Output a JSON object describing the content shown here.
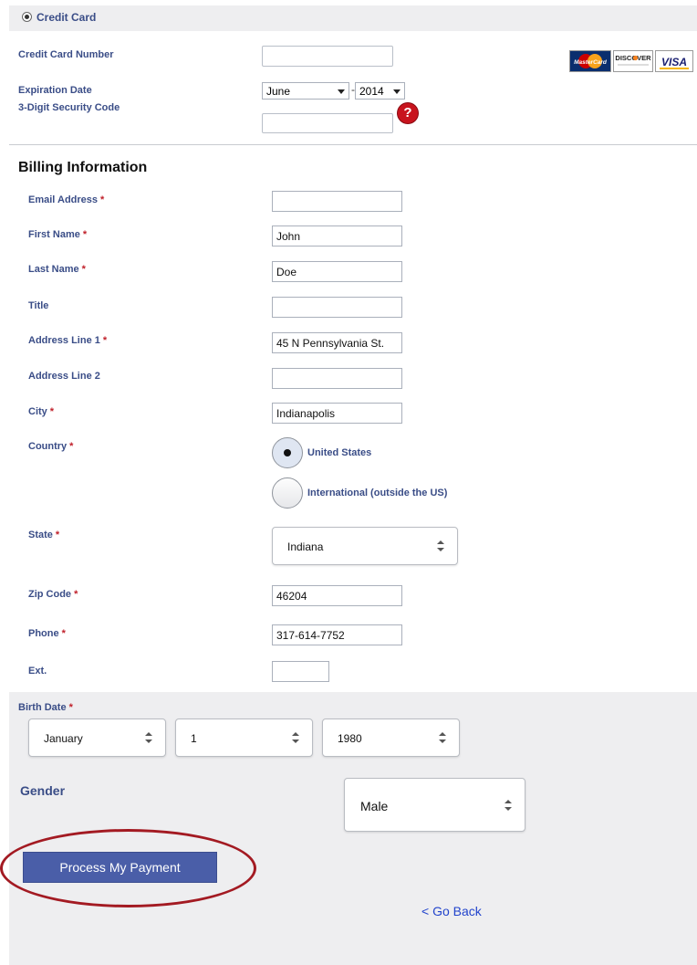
{
  "payment": {
    "method_label": "Credit Card",
    "card_number_label": "Credit Card Number",
    "card_number_value": "",
    "expiration_label": "Expiration Date",
    "exp_month": "June",
    "exp_sep": "-",
    "exp_year": "2014",
    "cvv_label": "3-Digit Security Code",
    "cvv_value": "",
    "help_glyph": "?",
    "cards": [
      {
        "name": "MasterCard",
        "color": "#cc0000"
      },
      {
        "name": "DISCOVER",
        "color": "#f58220"
      },
      {
        "name": "VISA",
        "color": "#1a1f71"
      }
    ]
  },
  "billing": {
    "heading": "Billing Information",
    "required_mark": "*",
    "email_label": "Email Address",
    "email_value": "",
    "first_name_label": "First Name",
    "first_name_value": "John",
    "last_name_label": "Last Name",
    "last_name_value": "Doe",
    "title_label": "Title",
    "title_value": "",
    "address1_label": "Address Line 1",
    "address1_value": "45 N Pennsylvania St.",
    "address2_label": "Address Line 2",
    "address2_value": "",
    "city_label": "City",
    "city_value": "Indianapolis",
    "country_label": "Country",
    "country_options": [
      "United States",
      "International (outside the US)"
    ],
    "state_label": "State",
    "state_value": "Indiana",
    "zip_label": "Zip Code",
    "zip_value": "46204",
    "phone_label": "Phone",
    "phone_value": "317-614-7752",
    "ext_label": "Ext.",
    "ext_value": ""
  },
  "birth": {
    "label": "Birth Date",
    "month": "January",
    "day": "1",
    "year": "1980"
  },
  "gender": {
    "label": "Gender",
    "value": "Male"
  },
  "actions": {
    "submit_label": "Process My Payment",
    "back_label": "< Go Back"
  },
  "colors": {
    "label_blue": "#3a4d87",
    "required_red": "#c0202a",
    "button_blue": "#4a5ea8",
    "highlight_ellipse": "#a31a22",
    "link_blue": "#2244cc"
  }
}
